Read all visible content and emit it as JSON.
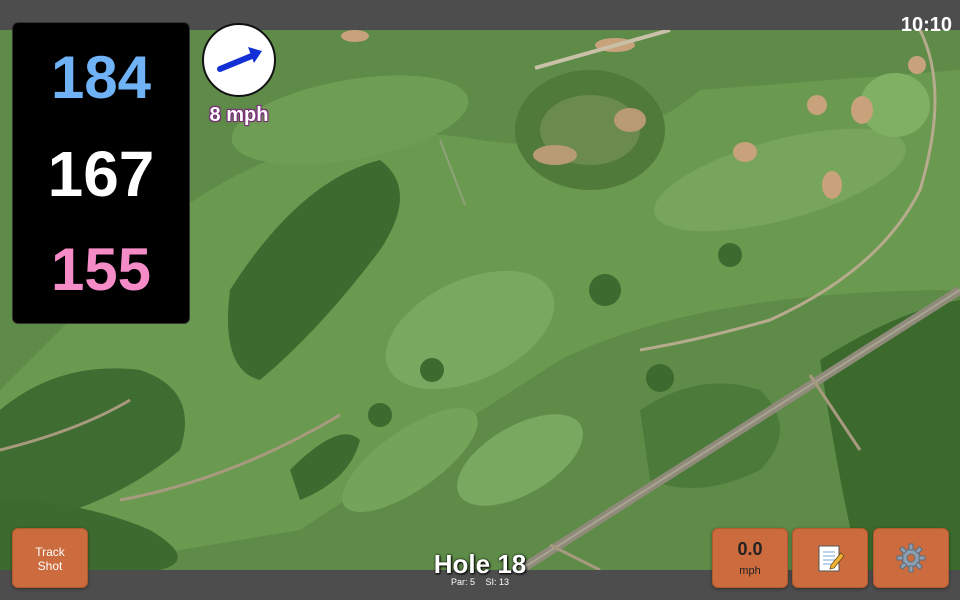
{
  "status": {
    "time": "10:10"
  },
  "distances": {
    "back": "184",
    "middle": "167",
    "front": "155"
  },
  "wind": {
    "speed": "8 mph",
    "icon": "wind-arrow-icon"
  },
  "buttons": {
    "track_shot_line1": "Track",
    "track_shot_line2": "Shot",
    "speed_value": "0.0",
    "speed_unit": "mph",
    "notes_icon": "notepad-icon",
    "settings_icon": "gear-icon"
  },
  "hole": {
    "title": "Hole 18",
    "par": "Par: 5",
    "si": "SI: 13"
  },
  "colors": {
    "back": "#6fb2f5",
    "middle": "#ffffff",
    "front": "#f58cc8",
    "button": "#cc6b3d"
  }
}
